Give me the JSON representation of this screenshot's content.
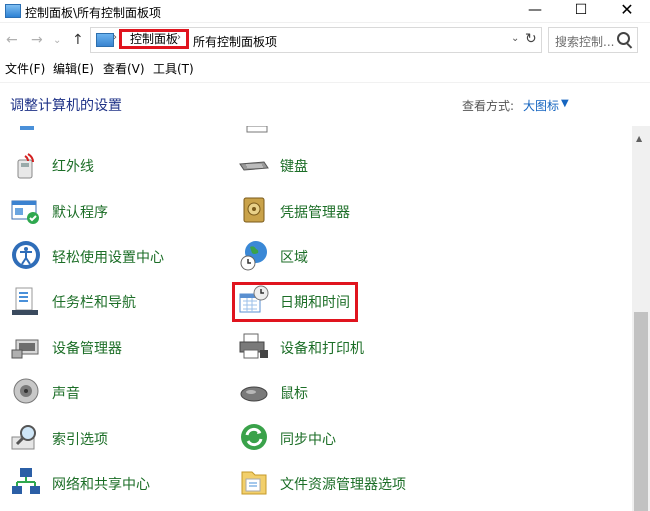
{
  "window": {
    "title": "控制面板\\所有控制面板项"
  },
  "window_controls": {
    "minimize": "—",
    "maximize": "☐",
    "close": "✕"
  },
  "nav": {
    "back": "←",
    "forward": "→",
    "recent": "⌄",
    "up": "↑"
  },
  "address": {
    "crumbs": [
      "控制面板",
      "所有控制面板项"
    ],
    "separator": "›",
    "dropdown": "⌄",
    "refresh": "↻"
  },
  "search": {
    "placeholder": "搜索控制..."
  },
  "menu": [
    "文件(F)",
    "编辑(E)",
    "查看(V)",
    "工具(T)"
  ],
  "header": {
    "title": "调整计算机的设置",
    "view_label": "查看方式:",
    "view_value": "大图标",
    "view_dropdown": "▼"
  },
  "left_items": [
    {
      "label": "红外线",
      "icon": "infrared-icon"
    },
    {
      "label": "默认程序",
      "icon": "default-programs-icon"
    },
    {
      "label": "轻松使用设置中心",
      "icon": "ease-of-access-icon"
    },
    {
      "label": "任务栏和导航",
      "icon": "taskbar-icon"
    },
    {
      "label": "设备管理器",
      "icon": "device-manager-icon"
    },
    {
      "label": "声音",
      "icon": "sound-icon"
    },
    {
      "label": "索引选项",
      "icon": "indexing-icon"
    },
    {
      "label": "网络和共享中心",
      "icon": "network-icon"
    }
  ],
  "right_items": [
    {
      "label": "键盘",
      "icon": "keyboard-icon"
    },
    {
      "label": "凭据管理器",
      "icon": "credential-manager-icon"
    },
    {
      "label": "区域",
      "icon": "region-icon"
    },
    {
      "label": "日期和时间",
      "icon": "date-time-icon"
    },
    {
      "label": "设备和打印机",
      "icon": "printer-icon"
    },
    {
      "label": "鼠标",
      "icon": "mouse-icon"
    },
    {
      "label": "同步中心",
      "icon": "sync-center-icon"
    },
    {
      "label": "文件资源管理器选项",
      "icon": "folder-options-icon"
    }
  ],
  "scrollbar": {
    "up_arrow": "▲"
  }
}
